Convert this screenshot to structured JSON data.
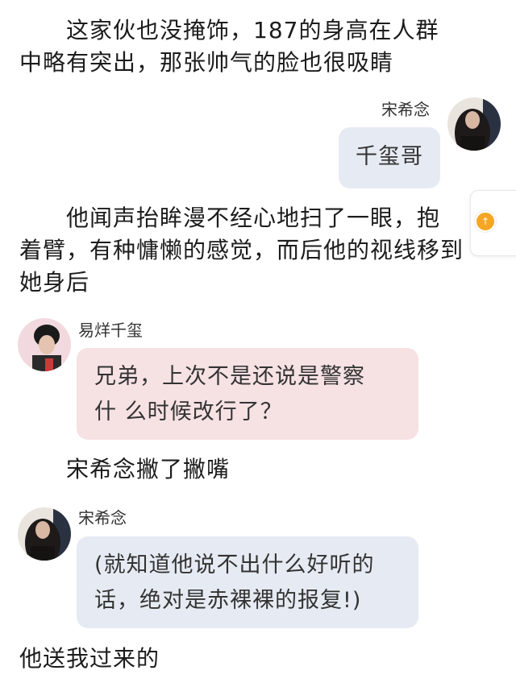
{
  "colors": {
    "narration_text": "#1c1c1c",
    "bubble_blue": "#e6ebf3",
    "bubble_pink": "#f6e1e3",
    "side_dot": "#f5a623"
  },
  "narration": [
    {
      "lines": [
        "　　这家伙也没掩饰，187的身高在人群",
        "中略有突出，那张帅气的脸也很吸睛"
      ]
    },
    {
      "lines": [
        "　　他闻声抬眸漫不经心地扫了一眼，抱",
        "着臂，有种慵懒的感觉，而后他的视线移到",
        "她身后"
      ]
    },
    {
      "lines": [
        "　　宋希念撇了撇嘴"
      ]
    },
    {
      "lines": [
        "他送我过来的"
      ]
    }
  ],
  "messages": [
    {
      "speaker": "宋希念",
      "side": "right",
      "text": "千玺哥",
      "avatar_icon": "woman-portrait-icon"
    },
    {
      "speaker": "易烊千玺",
      "side": "left",
      "lines": [
        "兄弟，上次不是还说是警察",
        "什 么时候改行了？"
      ],
      "avatar_icon": "man-portrait-icon"
    },
    {
      "speaker": "宋希念",
      "side": "left",
      "lines": [
        "(就知道他说不出什么好听的",
        "话，绝对是赤裸裸的报复!)"
      ],
      "avatar_icon": "woman-portrait-icon"
    }
  ],
  "side_widget": {
    "icon": "scroll-top-icon",
    "glyph": "↑"
  }
}
